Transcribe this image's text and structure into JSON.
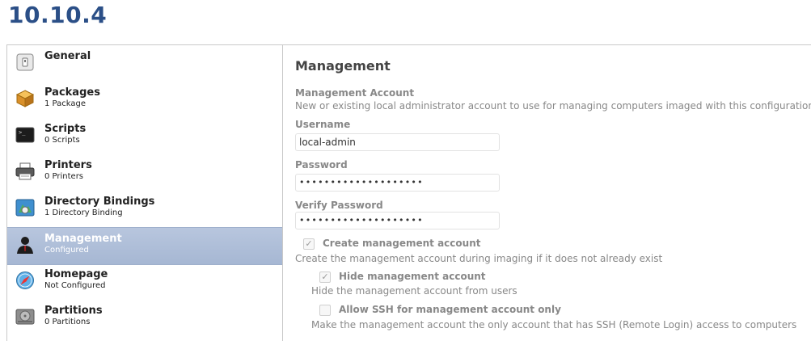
{
  "page": {
    "title": "10.10.4"
  },
  "sidebar": {
    "items": [
      {
        "label": "General",
        "sub": "",
        "icon": "general-icon"
      },
      {
        "label": "Packages",
        "sub": "1 Package",
        "icon": "package-icon"
      },
      {
        "label": "Scripts",
        "sub": "0 Scripts",
        "icon": "terminal-icon"
      },
      {
        "label": "Printers",
        "sub": "0 Printers",
        "icon": "printer-icon"
      },
      {
        "label": "Directory Bindings",
        "sub": "1 Directory Binding",
        "icon": "directory-icon"
      },
      {
        "label": "Management",
        "sub": "Configured",
        "icon": "user-icon",
        "selected": true
      },
      {
        "label": "Homepage",
        "sub": "Not Configured",
        "icon": "safari-icon"
      },
      {
        "label": "Partitions",
        "sub": "0 Partitions",
        "icon": "disk-icon"
      }
    ]
  },
  "management": {
    "heading": "Management",
    "account_section": {
      "title": "Management Account",
      "description": "New or existing local administrator account to use for managing computers imaged with this configuration"
    },
    "username": {
      "label": "Username",
      "value": "local-admin"
    },
    "password": {
      "label": "Password",
      "value": "••••••••••••••••••••"
    },
    "verify_password": {
      "label": "Verify Password",
      "value": "••••••••••••••••••••"
    },
    "create_account": {
      "label": "Create management account",
      "checked": true,
      "description": "Create the management account during imaging if it does not already exist"
    },
    "hide_account": {
      "label": "Hide management account",
      "checked": true,
      "description": "Hide the management account from users"
    },
    "allow_ssh": {
      "label": "Allow SSH for management account only",
      "checked": false,
      "description": "Make the management account the only account that has SSH (Remote Login) access to computers"
    }
  },
  "colors": {
    "title": "#2b4f87",
    "selected_bg": "#a6b7d3",
    "muted_text": "#888888"
  }
}
